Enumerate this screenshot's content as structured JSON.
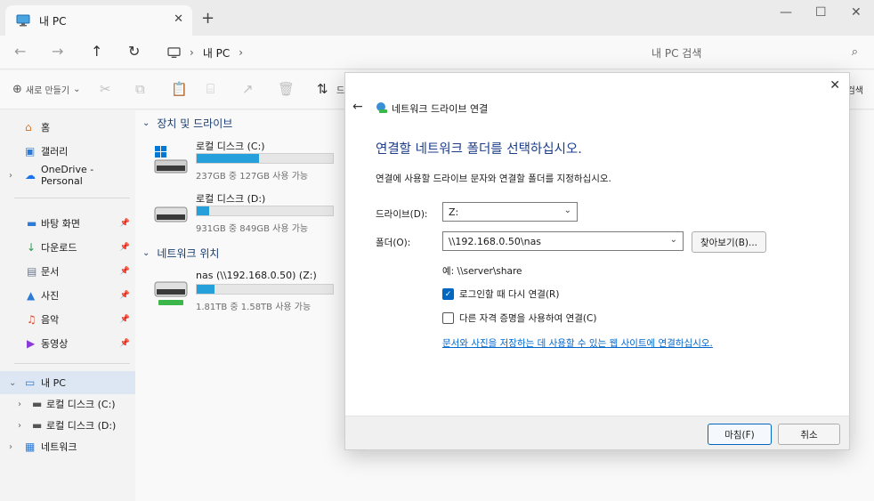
{
  "window": {
    "tab_title": "내 PC",
    "tab_close_glyph": "✕",
    "new_tab_glyph": "+",
    "minimize_glyph": "—",
    "maximize_glyph": "☐",
    "close_glyph": "✕"
  },
  "nav": {
    "back_glyph": "←",
    "forward_glyph": "→",
    "up_glyph": "↑",
    "refresh_glyph": "↻",
    "breadcrumb": [
      "내 PC"
    ],
    "breadcrumb_sep": "›",
    "search_placeholder": "내 PC 검색",
    "search_glyph": "⌕"
  },
  "commandbar": {
    "new_glyph": "⊕",
    "new_label": "새로 만들기",
    "new_dropdown_glyph": "⌄",
    "cut_glyph": "✂",
    "copy_glyph": "⧉",
    "paste_glyph": "📋",
    "rename_glyph": "⌸",
    "share_glyph": "↗",
    "delete_glyph": "🗑",
    "sort_glyph": "⇅",
    "sort_label_partial": "드",
    "right_label_partial": "검색"
  },
  "sidebar": {
    "expand_glyph": "›",
    "collapse_glyph": "⌄",
    "pin_glyph": "📌",
    "home": "홈",
    "gallery": "갤러리",
    "onedrive": "OneDrive - Personal",
    "quick": [
      {
        "label": "바탕 화면",
        "icon": "▬"
      },
      {
        "label": "다운로드",
        "icon": "↓"
      },
      {
        "label": "문서",
        "icon": "▤"
      },
      {
        "label": "사진",
        "icon": "▲"
      },
      {
        "label": "음악",
        "icon": "♫"
      },
      {
        "label": "동영상",
        "icon": "▶"
      }
    ],
    "this_pc": "내 PC",
    "drive_c": "로컬 디스크 (C:)",
    "drive_d": "로컬 디스크 (D:)",
    "network": "네트워크"
  },
  "content": {
    "group_chevron": "⌄",
    "devices_header": "장치 및 드라이브",
    "network_header": "네트워크 위치",
    "drives": [
      {
        "name": "로컬 디스크 (C:)",
        "info": "237GB 중 127GB 사용 가능",
        "used_fraction": 0.46
      },
      {
        "name": "로컬 디스크 (D:)",
        "info": "931GB 중 849GB 사용 가능",
        "used_fraction": 0.09
      }
    ],
    "network_drives": [
      {
        "name": "nas (\\\\192.168.0.50) (Z:)",
        "info": "1.81TB 중 1.58TB 사용 가능",
        "used_fraction": 0.13
      }
    ]
  },
  "dialog": {
    "close_glyph": "✕",
    "back_glyph": "←",
    "title": "네트워크 드라이브 연결",
    "heading": "연결할 네트워크 폴더를 선택하십시오.",
    "description": "연결에 사용할 드라이브 문자와 연결할 폴더를 지정하십시오.",
    "drive_label": "드라이브(D):",
    "drive_value": "Z:",
    "folder_label": "폴더(O):",
    "folder_value": "\\\\192.168.0.50\\nas",
    "combo_arrow": "⌄",
    "browse_label": "찾아보기(B)...",
    "example": "예: \\\\server\\share",
    "reconnect_label": "로그인할 때 다시 연결(R)",
    "reconnect_checked": true,
    "check_glyph": "✓",
    "credentials_label": "다른 자격 증명을 사용하여 연결(C)",
    "credentials_checked": false,
    "link_text": "문서와 사진을 저장하는 데 사용할 수 있는 웹 사이트에 연결하십시오.",
    "finish_label": "마침(F)",
    "cancel_label": "취소"
  },
  "colors": {
    "accent": "#0067c0",
    "drive_bar": "#26a0da",
    "heading": "#1c3c8a",
    "link": "#0066cc"
  }
}
